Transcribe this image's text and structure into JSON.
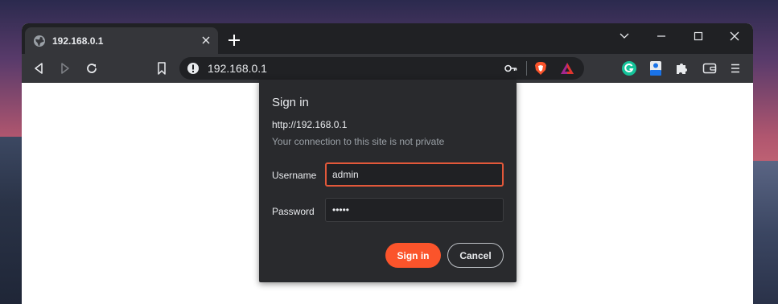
{
  "browser": {
    "tab": {
      "title": "192.168.0.1"
    },
    "address_bar": {
      "url": "192.168.0.1"
    }
  },
  "dialog": {
    "title": "Sign in",
    "site": "http://192.168.0.1",
    "warning": "Your connection to this site is not private",
    "username_label": "Username",
    "username_value": "admin",
    "password_label": "Password",
    "password_value": "•••••",
    "sign_in_label": "Sign in",
    "cancel_label": "Cancel"
  },
  "colors": {
    "accent": "#fb542b",
    "field_focus": "#e2583a",
    "dialog_bg": "#292a2d",
    "toolbar_bg": "#35363a",
    "tabbar_bg": "#202124"
  },
  "icons": {
    "tab": "globe-icon",
    "tab_close": "close-icon",
    "new_tab": "plus-icon",
    "back": "back-icon",
    "forward": "forward-icon",
    "reload": "reload-icon",
    "bookmark": "bookmark-icon",
    "site_info": "info-icon",
    "password_key": "key-icon",
    "brave_shields": "brave-lion-icon",
    "brave_rewards": "rewards-triangle-icon",
    "grammarly": "grammarly-icon",
    "translate": "translate-icon",
    "extensions": "puzzle-icon",
    "wallet": "wallet-icon",
    "menu": "menu-icon",
    "tab_search": "chevron-down-icon",
    "minimize": "minimize-icon",
    "maximize": "maximize-icon",
    "window_close": "window-close-icon"
  }
}
